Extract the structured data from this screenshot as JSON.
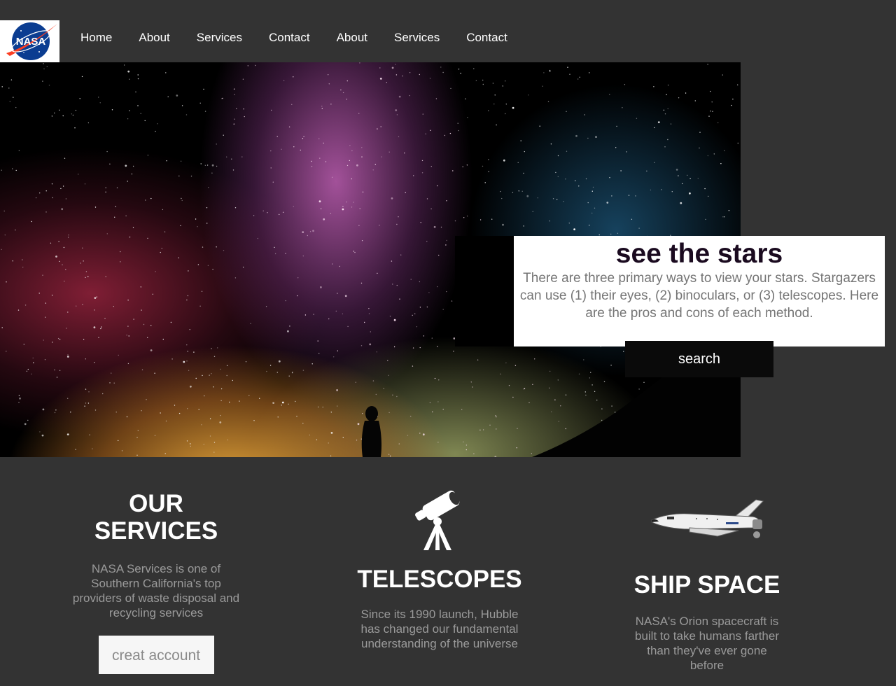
{
  "header": {
    "logo_text": "NASA",
    "nav": [
      "Home",
      "About",
      "Services",
      "Contact",
      "About",
      "Services",
      "Contact"
    ]
  },
  "hero": {
    "title": "see the stars",
    "body": "There are three primary ways to view your stars. Stargazers can use (1) their eyes, (2) binoculars, or (3) telescopes. Here are the pros and cons of each method.",
    "search_label": "search"
  },
  "services": {
    "heading_line1": "OUR",
    "heading_line2": "SERVICES",
    "description": "NASA Services is one of Southern California's top providers of waste disposal and recycling services",
    "create_label": "creat account"
  },
  "telescopes": {
    "icon": "telescope-icon",
    "heading": "TELESCOPES",
    "description": "Since its 1990 launch, Hubble has changed our fundamental understanding of the universe"
  },
  "ship": {
    "icon": "space-shuttle-icon",
    "heading": "SHIP SPACE",
    "description": "NASA's Orion spacecraft is built to take humans farther than they've ever gone before"
  },
  "colors": {
    "page_bg": "#333333",
    "card_bg": "#ffffff",
    "button_dark": "#0a0a0a",
    "muted_text": "#9a9a9a"
  }
}
